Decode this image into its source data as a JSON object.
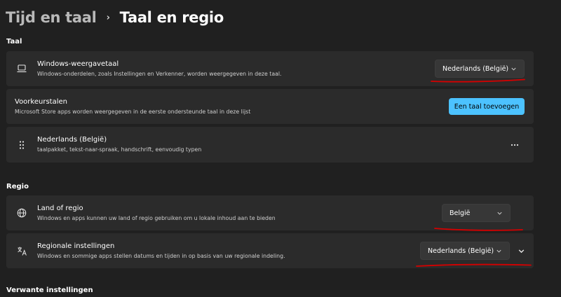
{
  "breadcrumb": {
    "parent": "Tijd en taal",
    "separator": "›",
    "current": "Taal en regio"
  },
  "sections": {
    "language": "Taal",
    "region": "Regio",
    "related": "Verwante instellingen"
  },
  "display_language": {
    "icon": "laptop-icon",
    "title": "Windows-weergavetaal",
    "description": "Windows-onderdelen, zoals Instellingen en Verkenner, worden weergegeven in deze taal.",
    "selected": "Nederlands (België)"
  },
  "preferred_languages": {
    "title": "Voorkeurstalen",
    "description": "Microsoft Store apps worden weergegeven in de eerste ondersteunde taal in deze lijst",
    "add_button": "Een taal toevoegen"
  },
  "language_item": {
    "icon": "drag-handle-icon",
    "title": "Nederlands (België)",
    "description": "taalpakket, tekst-naar-spraak, handschrift, eenvoudig typen"
  },
  "country_region": {
    "icon": "globe-icon",
    "title": "Land of regio",
    "description": "Windows en apps kunnen uw land of regio gebruiken om u lokale inhoud aan te bieden",
    "selected": "België"
  },
  "regional_format": {
    "icon": "language-format-icon",
    "title": "Regionale instellingen",
    "description": "Windows en sommige apps stellen datums en tijden in op basis van uw regionale indeling.",
    "selected": "Nederlands (België)"
  },
  "colors": {
    "background": "#202020",
    "card": "#2b2b2b",
    "accent": "#4cc2ff",
    "annotation": "#d60000"
  }
}
